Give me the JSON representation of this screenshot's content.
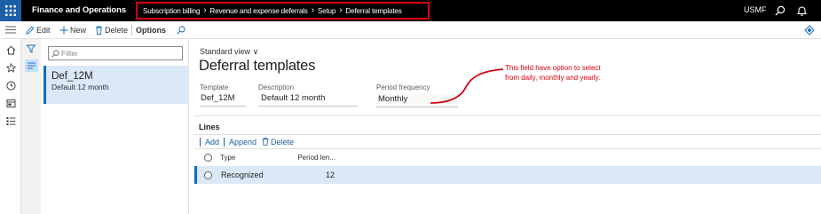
{
  "topbar": {
    "app_name": "Finance and Operations",
    "breadcrumbs": [
      "Subscription billing",
      "Revenue and expense deferrals",
      "Setup",
      "Deferral templates"
    ],
    "company": "USMF",
    "icons": [
      "waffle-icon",
      "search-icon",
      "bell-icon"
    ]
  },
  "actionpane": {
    "edit_label": "Edit",
    "new_label": "New",
    "delete_label": "Delete",
    "options_label": "Options"
  },
  "listpane": {
    "filter_placeholder": "Filter",
    "records": [
      {
        "id": "Def_12M",
        "description": "Default 12 month"
      }
    ]
  },
  "details": {
    "view_name": "Standard view",
    "page_title": "Deferral templates",
    "fields": {
      "template_label": "Template",
      "template_value": "Def_12M",
      "description_label": "Description",
      "description_value": "Default 12 month",
      "frequency_label": "Period frequency",
      "frequency_value": "Monthly"
    },
    "annotation": "This field have option to select from daily, monthly and yearly.",
    "lines": {
      "title": "Lines",
      "add_label": "Add",
      "append_label": "Append",
      "delete_label": "Delete",
      "columns": [
        "Type",
        "Period len..."
      ],
      "rows": [
        {
          "type": "Recognized",
          "period_length": "12"
        }
      ]
    }
  },
  "colors": {
    "topbar": "#000000",
    "waffle": "#1e5fa8",
    "highlight_box": "#d6000d",
    "selection": "#dbe8f8",
    "accent": "#0f6cbd"
  }
}
